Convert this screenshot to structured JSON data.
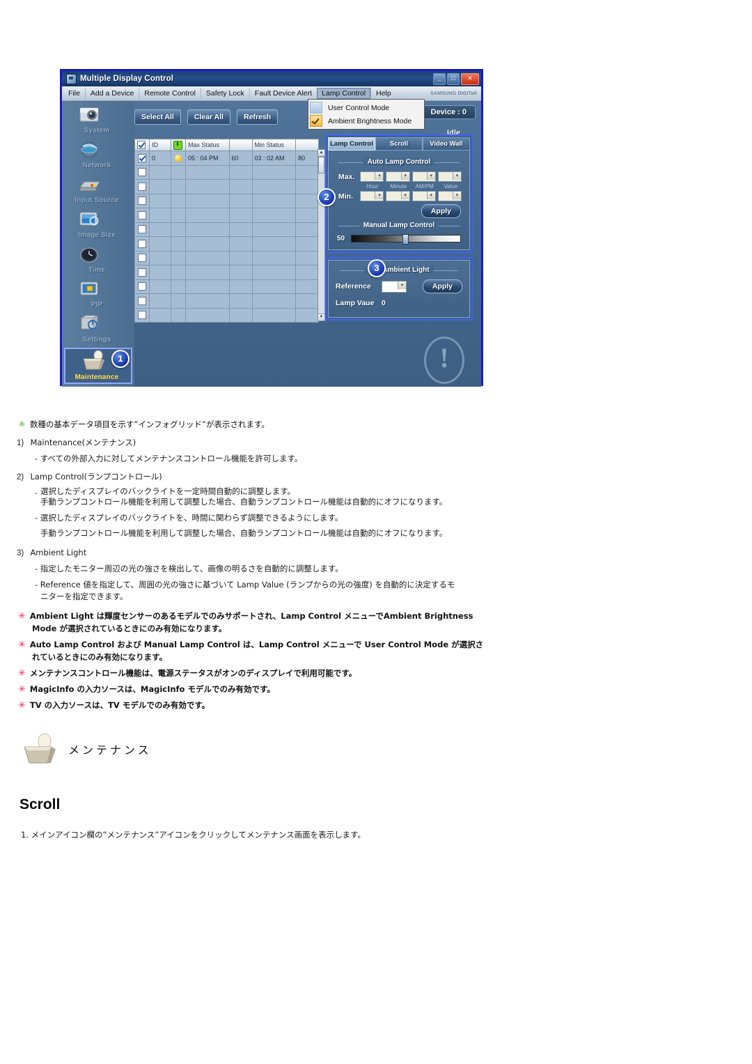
{
  "app": {
    "title": "Multiple Display Control",
    "window_buttons": [
      "minimize",
      "maximize",
      "close"
    ],
    "brand_logo": "SAMSUNG DIGITall",
    "menu": [
      {
        "label": "File",
        "active": false
      },
      {
        "label": "Add a Device",
        "active": false
      },
      {
        "label": "Remote Control",
        "active": false
      },
      {
        "label": "Safety Lock",
        "active": false
      },
      {
        "label": "Fault Device Alert",
        "active": false
      },
      {
        "label": "Lamp Control",
        "active": true
      },
      {
        "label": "Help",
        "active": false
      }
    ],
    "dropdown": {
      "items": [
        {
          "label": "User Control Mode",
          "checked": false
        },
        {
          "label": "Ambient Brightness Mode",
          "checked": true
        }
      ]
    },
    "device_label": "Device : 0",
    "status_label": "Idle",
    "sidebar": [
      {
        "label": "System",
        "icon": "camera-icon",
        "selected": false
      },
      {
        "label": "Network",
        "icon": "globe-icon",
        "selected": false
      },
      {
        "label": "Input Source",
        "icon": "device-icon",
        "selected": false
      },
      {
        "label": "Image Size",
        "icon": "monitor-icon",
        "selected": false
      },
      {
        "label": "Time",
        "icon": "clock-icon",
        "selected": false
      },
      {
        "label": "PIP",
        "icon": "pip-icon",
        "selected": false
      },
      {
        "label": "Settings",
        "icon": "settings-icon",
        "selected": false
      },
      {
        "label": "Maintenance",
        "icon": "maintenance-icon",
        "selected": true,
        "badge": "1"
      }
    ],
    "toolbar_buttons": [
      "Select All",
      "Clear All",
      "Refresh"
    ],
    "table": {
      "headers": [
        "",
        "ID",
        "",
        "Max Status",
        "",
        "Min Status",
        ""
      ],
      "header_labels": {
        "id": "ID",
        "max": "Max Status",
        "min": "Min Status"
      },
      "rows": [
        {
          "checked": true,
          "id": "0",
          "lamp": true,
          "max_time": "05 : 04  PM",
          "max_value": "60",
          "min_time": "03 : 02  AM",
          "min_value": "80"
        },
        {
          "checked": false,
          "id": "",
          "lamp": false,
          "max_time": "",
          "max_value": "",
          "min_time": "",
          "min_value": ""
        },
        {
          "checked": false,
          "id": "",
          "lamp": false,
          "max_time": "",
          "max_value": "",
          "min_time": "",
          "min_value": ""
        },
        {
          "checked": false,
          "id": "",
          "lamp": false,
          "max_time": "",
          "max_value": "",
          "min_time": "",
          "min_value": ""
        },
        {
          "checked": false,
          "id": "",
          "lamp": false,
          "max_time": "",
          "max_value": "",
          "min_time": "",
          "min_value": ""
        },
        {
          "checked": false,
          "id": "",
          "lamp": false,
          "max_time": "",
          "max_value": "",
          "min_time": "",
          "min_value": ""
        },
        {
          "checked": false,
          "id": "",
          "lamp": false,
          "max_time": "",
          "max_value": "",
          "min_time": "",
          "min_value": ""
        },
        {
          "checked": false,
          "id": "",
          "lamp": false,
          "max_time": "",
          "max_value": "",
          "min_time": "",
          "min_value": ""
        },
        {
          "checked": false,
          "id": "",
          "lamp": false,
          "max_time": "",
          "max_value": "",
          "min_time": "",
          "min_value": ""
        },
        {
          "checked": false,
          "id": "",
          "lamp": false,
          "max_time": "",
          "max_value": "",
          "min_time": "",
          "min_value": ""
        },
        {
          "checked": false,
          "id": "",
          "lamp": false,
          "max_time": "",
          "max_value": "",
          "min_time": "",
          "min_value": ""
        },
        {
          "checked": false,
          "id": "",
          "lamp": false,
          "max_time": "",
          "max_value": "",
          "min_time": "",
          "min_value": ""
        }
      ]
    },
    "tabs": [
      {
        "label": "Lamp Control",
        "active": true
      },
      {
        "label": "Scroll",
        "active": false
      },
      {
        "label": "Video Wall",
        "active": false
      }
    ],
    "lamp_panel": {
      "badge": "2",
      "auto_legend": "Auto Lamp Control",
      "max_label": "Max.",
      "min_label": "Min.",
      "column_labels": [
        "Hour",
        "Minute",
        "AM/PM",
        "Value"
      ],
      "apply_label": "Apply",
      "manual_legend": "Manual Lamp Control",
      "manual_value": "50"
    },
    "ambient_panel": {
      "badge": "3",
      "title": "Ambient Light",
      "reference_label": "Reference",
      "apply_label": "Apply",
      "lamp_value_label": "Lamp Vaue",
      "lamp_value": "0"
    }
  },
  "doc": {
    "note_top": "数種の基本データ項目を示す”インフォグリッド”が表示されます。",
    "items": [
      {
        "num": "1)",
        "title": "Maintenance(メンテナンス)",
        "lines": [
          "-  すべての外部入力に対してメンテナンスコントロール機能を許可します。"
        ]
      },
      {
        "num": "2)",
        "title": "Lamp Control(ランプコントロール)",
        "lines": [
          "選択したディスプレイのバックライトを一定時間自動的に調整します。",
          "手動ランプコントロール機能を利用して調整した場合、自動ランプコントロール機能は自動的にオフになります。",
          "-  選択したディスプレイのバックライトを、時間に関わらず調整できるようにします。",
          "手動ランプコントロール機能を利用して調整した場合、自動ランプコントロール機能は自動的にオフになります。"
        ]
      },
      {
        "num": "3)",
        "title": "Ambient Light",
        "lines": [
          "-  指定したモニター周辺の光の強さを検出して、画像の明るさを自動的に調整します。",
          "-  Reference 値を指定して、周囲の光の強さに基づいて Lamp Value (ランプからの光の強度) を自動的に決定するモ",
          "ニターを指定できます。"
        ]
      }
    ],
    "red_notes": [
      "Ambient Light は輝度センサーのあるモデルでのみサポートされ、Lamp Control メニューでAmbient Brightness",
      "Mode が選択されているときにのみ有効になります。",
      "Auto Lamp Control および Manual Lamp Control は、Lamp Control メニューで User Control Mode が選択さ",
      "れているときにのみ有効になります。",
      "メンテナンスコントロール機能は、電源ステータスがオンのディスプレイで利用可能です。",
      "MagicInfo の入力ソースは、MagicInfo モデルでのみ有効です。",
      "TV の入力ソースは、TV モデルでのみ有効です。"
    ],
    "maintenance_heading": "メンテナンス",
    "scroll_heading": "Scroll",
    "scroll_step": "1.  メインアイコン欄の”メンテナンス”アイコンをクリックしてメンテナンス画面を表示します。"
  },
  "colors": {
    "window_border": "#1b1bc6",
    "accent_blue": "#3f5fff",
    "green_star": "#5aaf2f",
    "red_star": "#e8225f",
    "badge_blue": "#1632a8",
    "selected_label": "#ffe14f"
  }
}
